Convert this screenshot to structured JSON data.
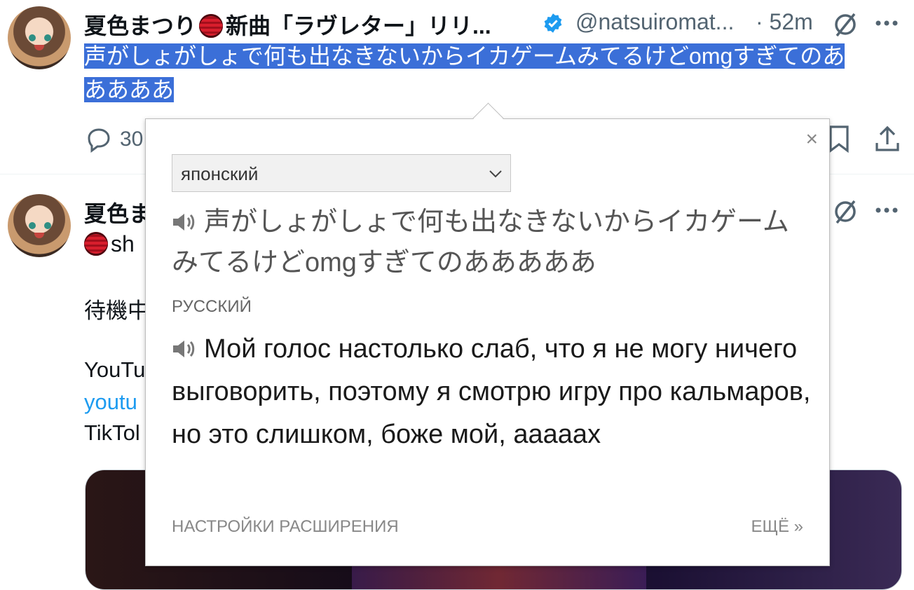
{
  "tweet1": {
    "name": "夏色まつり",
    "name_suffix": "新曲「ラヴレター」リリ...",
    "handle": "@natsuiromat...",
    "time": "· 52m",
    "text_line1": "声がしょがしょで何も出なきないからイカゲームみてるけどomgすぎてのあ",
    "text_line2": "ああああ",
    "reply_count": "30"
  },
  "tweet2": {
    "name": "夏色ま",
    "name_line2": "sh",
    "body_line1": "待機中",
    "body_line2": "YouTu",
    "body_link": "youtu",
    "body_line4": "TikTol"
  },
  "popup": {
    "source_lang": "японский",
    "source_text": "声がしょがしょで何も出なきないからイカゲームみてるけどomgすぎてのあああああ",
    "target_lang": "РУССКИЙ",
    "target_text": "Мой голос настолько слаб, что я не могу ничего выговорить, поэтому я смотрю игру про кальмаров, но это слишком, боже мой, аааааx",
    "settings_link": "НАСТРОЙКИ РАСШИРЕНИЯ",
    "more_link": "ЕЩЁ »",
    "close": "×"
  }
}
